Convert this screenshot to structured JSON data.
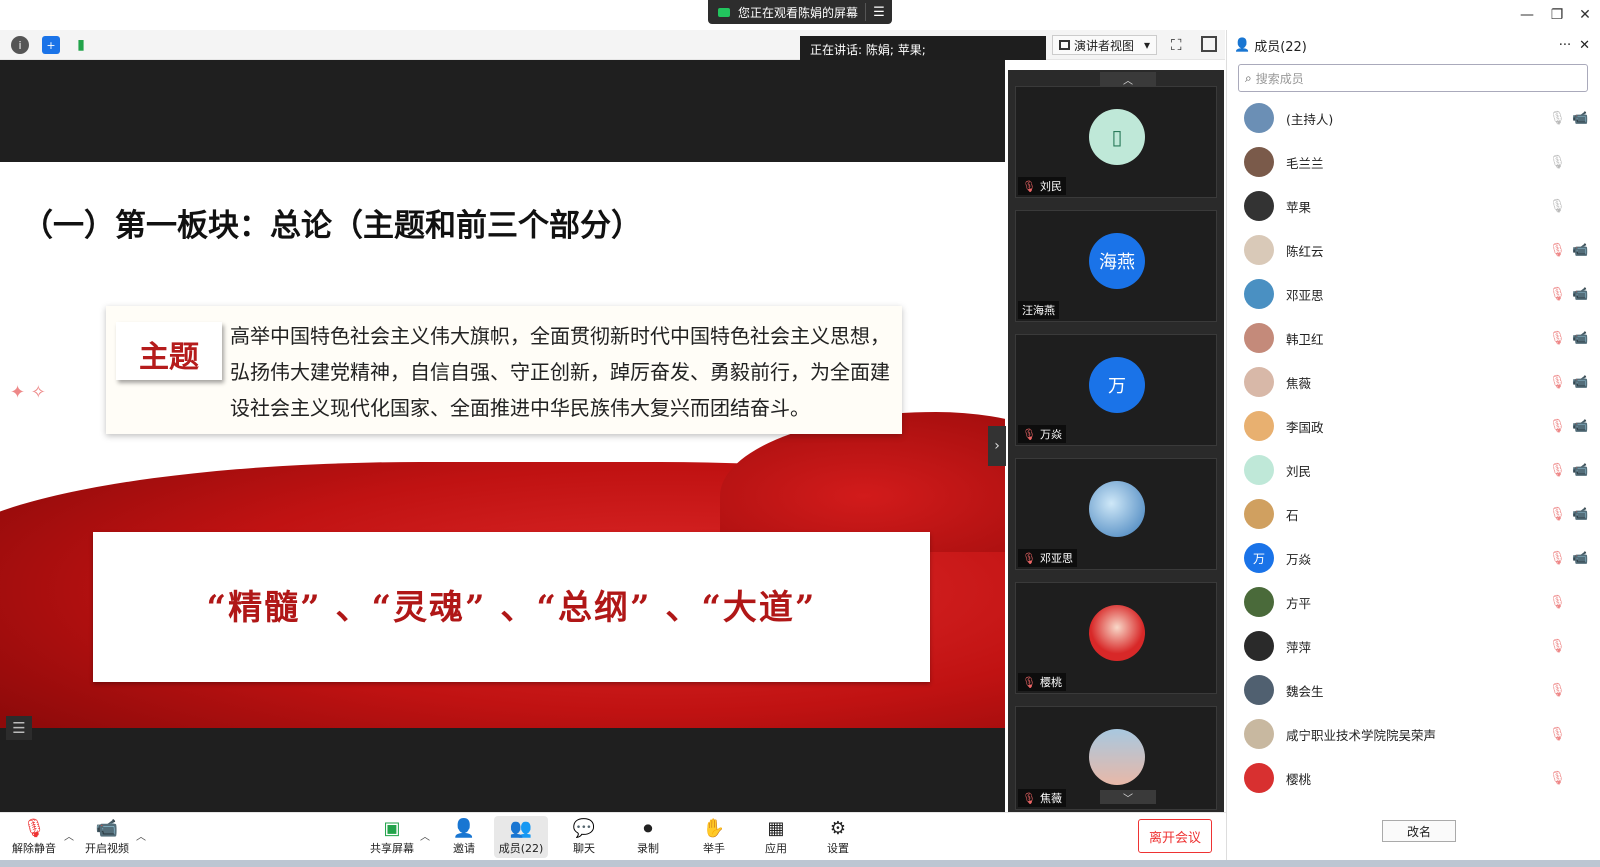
{
  "banner": {
    "text": "您正在观看陈娟的屏幕",
    "menu_icon": "menu-icon"
  },
  "window": {
    "minimize": "—",
    "restore": "❐",
    "close": "✕"
  },
  "speaking": {
    "text": "正在讲话: 陈娟; 苹果;"
  },
  "view": {
    "label": "演讲者视图",
    "caret": "▾"
  },
  "slide": {
    "title": "（一）第一板块：总论（主题和前三个部分）",
    "theme_label": "主题",
    "theme_text": "高举中国特色社会主义伟大旗帜，全面贯彻新时代中国特色社会主义思想，弘扬伟大建党精神，自信自强、守正创新，踔厉奋发、勇毅前行，为全面建设社会主义现代化国家、全面推进中华民族伟大复兴而团结奋斗。",
    "keywords": "“精髓” 、“灵魂” 、“总纲” 、“大道”"
  },
  "gallery": {
    "tiles": [
      {
        "name": "刘民",
        "avatar_text": ""
      },
      {
        "name": "汪海燕",
        "avatar_text": "海燕"
      },
      {
        "name": "万焱",
        "avatar_text": "万"
      },
      {
        "name": "邓亚思",
        "avatar_text": ""
      },
      {
        "name": "樱桃",
        "avatar_text": ""
      },
      {
        "name": "焦薇",
        "avatar_text": ""
      }
    ]
  },
  "panel": {
    "title": "成员(22)",
    "more": "···",
    "search_placeholder": "搜索成员",
    "rename": "改名",
    "members": [
      {
        "name": "(主持人)",
        "avatar": "",
        "color": "#6b8fb5"
      },
      {
        "name": "毛兰兰",
        "avatar": "",
        "color": "#7a5a4a"
      },
      {
        "name": "苹果",
        "avatar": "",
        "color": "#333333"
      },
      {
        "name": "陈红云",
        "avatar": "",
        "color": "#d9c9b8"
      },
      {
        "name": "邓亚思",
        "avatar": "",
        "color": "#4a90c2"
      },
      {
        "name": "韩卫红",
        "avatar": "",
        "color": "#c48a7a"
      },
      {
        "name": "焦薇",
        "avatar": "",
        "color": "#d8b8a8"
      },
      {
        "name": "李国政",
        "avatar": "",
        "color": "#e8b070"
      },
      {
        "name": "刘民",
        "avatar": "",
        "color": "#bfe8d8"
      },
      {
        "name": "石",
        "avatar": "",
        "color": "#d0a060"
      },
      {
        "name": "万焱",
        "avatar": "万",
        "color": "#1a73e8"
      },
      {
        "name": "方平",
        "avatar": "",
        "color": "#4a6a3a"
      },
      {
        "name": "萍萍",
        "avatar": "",
        "color": "#2a2a2a"
      },
      {
        "name": "魏会生",
        "avatar": "",
        "color": "#506070"
      },
      {
        "name": "咸宁职业技术学院院吴荣声",
        "avatar": "",
        "color": "#c8b8a0"
      },
      {
        "name": "樱桃",
        "avatar": "",
        "color": "#d83030"
      }
    ]
  },
  "bottom": {
    "unmute": "解除静音",
    "start_video": "开启视频",
    "share": "共享屏幕",
    "invite": "邀请",
    "members": "成员(22)",
    "chat": "聊天",
    "record": "录制",
    "raise_hand": "举手",
    "apps": "应用",
    "settings": "设置",
    "leave": "离开会议"
  },
  "colors": {
    "accent": "#1a73e8",
    "leave": "#e33333",
    "slide_red": "#c01212"
  }
}
